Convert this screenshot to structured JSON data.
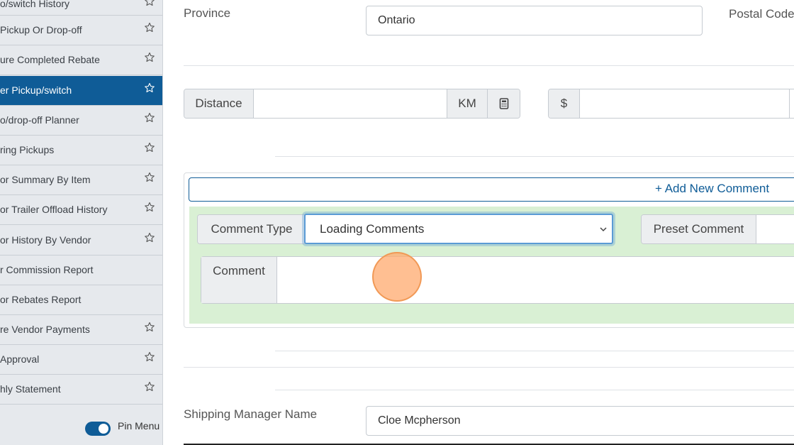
{
  "sidebar": {
    "items": [
      {
        "label": "o/switch History",
        "starred": true
      },
      {
        "label": "Pickup Or Drop-off",
        "starred": true
      },
      {
        "label": "ure Completed Rebate",
        "starred": true
      },
      {
        "label": "er Pickup/switch",
        "starred": true,
        "active": true
      },
      {
        "label": "o/drop-off Planner",
        "starred": true
      },
      {
        "label": "ring Pickups",
        "starred": true
      },
      {
        "label": "or Summary By Item",
        "starred": true
      },
      {
        "label": "or Trailer Offload History",
        "starred": true
      },
      {
        "label": "or History By Vendor",
        "starred": true
      },
      {
        "label": "r Commission Report",
        "starred": false
      },
      {
        "label": "or Rebates Report",
        "starred": false
      },
      {
        "label": "re Vendor Payments",
        "starred": true
      },
      {
        "label": " Approval",
        "starred": true
      },
      {
        "label": "hly Statement",
        "starred": true
      }
    ],
    "pin_menu_label": "Pin Menu"
  },
  "address": {
    "province_label": "Province",
    "province_value": "Ontario",
    "postal_label": "Postal Code"
  },
  "distance": {
    "label": "Distance",
    "value": "",
    "unit": "KM",
    "currency": "$",
    "amount": ""
  },
  "comments": {
    "add_link": "+ Add New Comment",
    "type_label": "Comment Type",
    "type_value": "Loading Comments",
    "preset_label": "Preset Comment",
    "comment_label": "Comment",
    "comment_value": ""
  },
  "shipping": {
    "manager_label": "Shipping Manager Name",
    "manager_value": "Cloe Mcpherson"
  },
  "colors": {
    "accent": "#0f5c97",
    "comment_panel_bg": "#d9f0d4",
    "focus_ring": "#5b9bd5"
  }
}
